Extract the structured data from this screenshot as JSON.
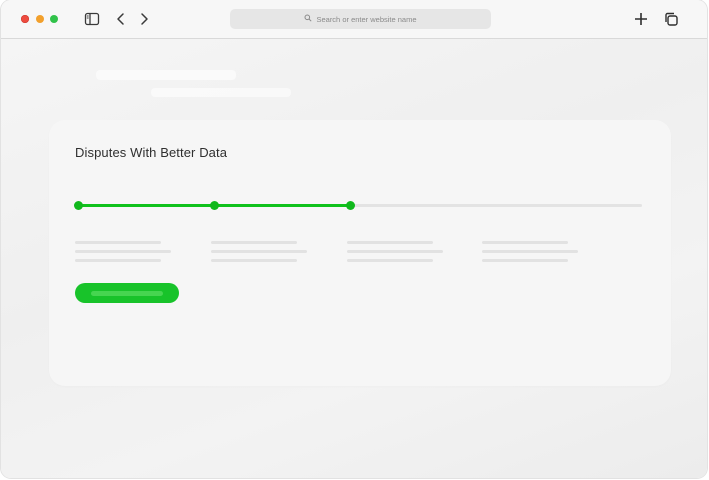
{
  "browser": {
    "traffic_lights": [
      {
        "name": "close",
        "color": "#ee4b3f"
      },
      {
        "name": "minimize",
        "color": "#f2a02c"
      },
      {
        "name": "zoom",
        "color": "#31c24a"
      }
    ],
    "icons": {
      "sidebar": "sidebar-toggle-icon",
      "back": "chevron-left-icon",
      "forward": "chevron-right-icon",
      "search": "magnifier-icon",
      "new_tab": "plus-icon",
      "tabs": "tab-overview-icon"
    },
    "address_bar": {
      "placeholder": "Search or enter website name"
    }
  },
  "card": {
    "title": "Disputes With Better Data",
    "progress": {
      "steps_total": 4,
      "steps_completed": 3,
      "fill_color": "#10c21c",
      "track_color": "#e3e3e3"
    },
    "cta": {
      "color": "#18c32a"
    }
  }
}
